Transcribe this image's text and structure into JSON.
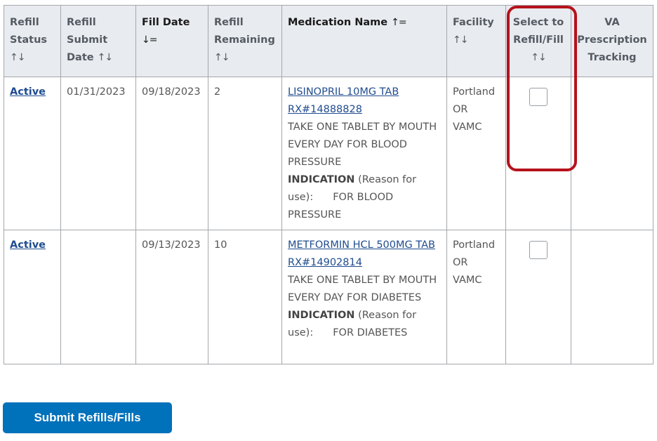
{
  "table": {
    "columns": [
      {
        "label": "Refill Status",
        "sort_icon": "↑↓",
        "sort_state": "unsorted"
      },
      {
        "label": "Refill Submit Date",
        "sort_icon": "↑↓",
        "sort_state": "unsorted"
      },
      {
        "label": "Fill Date",
        "sort_icon": "↓=",
        "sort_state": "descending"
      },
      {
        "label": "Refill Remaining",
        "sort_icon": "↑↓",
        "sort_state": "unsorted"
      },
      {
        "label": "Medication Name",
        "sort_icon": "↑=",
        "sort_state": "ascending"
      },
      {
        "label": "Facility",
        "sort_icon": "↑↓",
        "sort_state": "unsorted"
      },
      {
        "label": "Select to Refill/Fill",
        "sort_icon": "↑↓",
        "sort_state": "unsorted"
      },
      {
        "label": "VA Prescription Tracking",
        "sort_icon": "",
        "sort_state": "none"
      }
    ],
    "header_lines": {
      "c0": [
        "Refill",
        "Status"
      ],
      "c1": [
        "Refill",
        "Submit",
        "Date"
      ],
      "c2": [
        "Fill Date"
      ],
      "c3": [
        "Refill",
        "Remaining"
      ],
      "c4": [
        "Medication Name"
      ],
      "c5": [
        "Facility"
      ],
      "c6": [
        "Select to",
        "Refill/Fill"
      ],
      "c7": [
        "VA",
        "Prescription",
        "Tracking"
      ]
    },
    "rows": [
      {
        "status": "Active",
        "submit_date": "01/31/2023",
        "fill_date": "09/18/2023",
        "refills_remaining": "2",
        "med_name": "LISINOPRIL 10MG TAB",
        "rx_number": "RX#14888828",
        "sig": "TAKE ONE TABLET BY MOUTH EVERY DAY FOR BLOOD PRESSURE",
        "indication_label": "INDICATION",
        "indication_prefix": "(Reason for use):",
        "indication": "FOR BLOOD PRESSURE",
        "facility": "Portland OR VAMC",
        "selected": false,
        "tracking": ""
      },
      {
        "status": "Active",
        "submit_date": "",
        "fill_date": "09/13/2023",
        "refills_remaining": "10",
        "med_name": "METFORMIN HCL 500MG TAB",
        "rx_number": "RX#14902814",
        "sig": "TAKE ONE TABLET BY MOUTH EVERY DAY FOR DIABETES",
        "indication_label": "INDICATION",
        "indication_prefix": "(Reason for use):",
        "indication": "FOR DIABETES",
        "facility": "Portland OR VAMC",
        "selected": false,
        "tracking": ""
      }
    ]
  },
  "submit_button": {
    "label": "Submit Refills/Fills"
  },
  "colors": {
    "link": "#1f4c8f",
    "button": "#0071bb",
    "highlight": "#b5121b",
    "header_bg": "#e8ebef"
  }
}
